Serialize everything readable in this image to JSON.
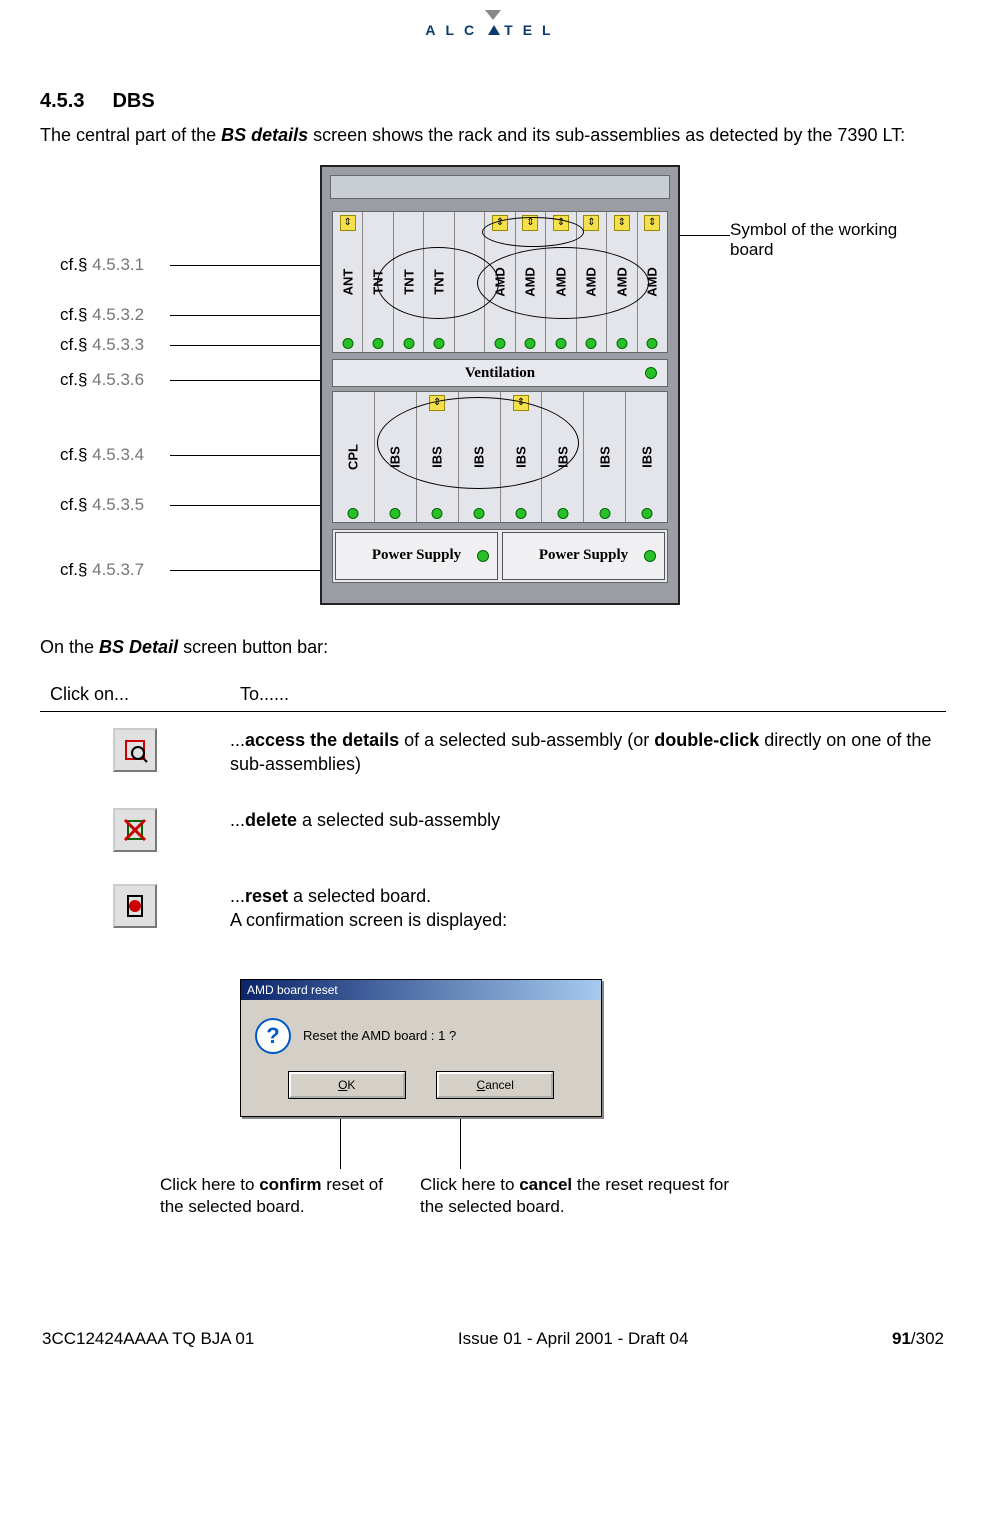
{
  "logo": {
    "text_left": "ALC",
    "text_right": "TEL"
  },
  "section": {
    "number": "4.5.3",
    "title": "DBS"
  },
  "intro": {
    "pre": "The central part of the ",
    "bold": "BS details",
    "post": " screen shows the rack and its sub-assemblies as detected by the 7390 LT:"
  },
  "callouts_left": [
    "cf.§ 4.5.3.1",
    "cf.§ 4.5.3.2",
    "cf.§ 4.5.3.3",
    "cf.§ 4.5.3.6",
    "cf.§ 4.5.3.4",
    "cf.§ 4.5.3.5",
    "cf.§ 4.5.3.7"
  ],
  "callout_right": "Symbol of the working board",
  "rack": {
    "shelf1_slots": [
      "ANT",
      "TNT",
      "TNT",
      "TNT",
      "",
      "AMD",
      "AMD",
      "AMD",
      "AMD",
      "AMD",
      "AMD"
    ],
    "ventilation": "Ventilation",
    "shelf2_slots": [
      "CPL",
      "IBS",
      "IBS",
      "IBS",
      "IBS",
      "IBS",
      "IBS",
      "IBS"
    ],
    "power_supply": "Power Supply"
  },
  "button_bar_intro": {
    "pre": "On the ",
    "bold": "BS Detail",
    "post": " screen button bar:"
  },
  "table": {
    "h1": "Click on...",
    "h2": "To......",
    "rows": [
      {
        "pre": "...",
        "b1": "access the details",
        "mid": " of a selected sub-assembly (or ",
        "b2": "double-click",
        "post": " directly on one of the sub-assemblies)"
      },
      {
        "pre": "...",
        "b1": "delete",
        "post": " a selected sub-assembly"
      },
      {
        "pre": "...",
        "b1": "reset",
        "mid": " a selected board.",
        "line2": "A confirmation screen is displayed:"
      }
    ]
  },
  "dialog": {
    "title": "AMD board reset",
    "message": "Reset the AMD board : 1 ?",
    "ok": "OK",
    "cancel": "Cancel"
  },
  "dlg_callouts": {
    "confirm_pre": "Click here to ",
    "confirm_b": "confirm",
    "confirm_post": " reset of the selected board.",
    "cancel_pre": "Click here to ",
    "cancel_b": "cancel",
    "cancel_post": " the reset request for the selected board."
  },
  "footer": {
    "doc": "3CC12424AAAA TQ BJA 01",
    "issue": "Issue 01 - April 2001 - Draft 04",
    "page": "91",
    "total": "/302"
  }
}
